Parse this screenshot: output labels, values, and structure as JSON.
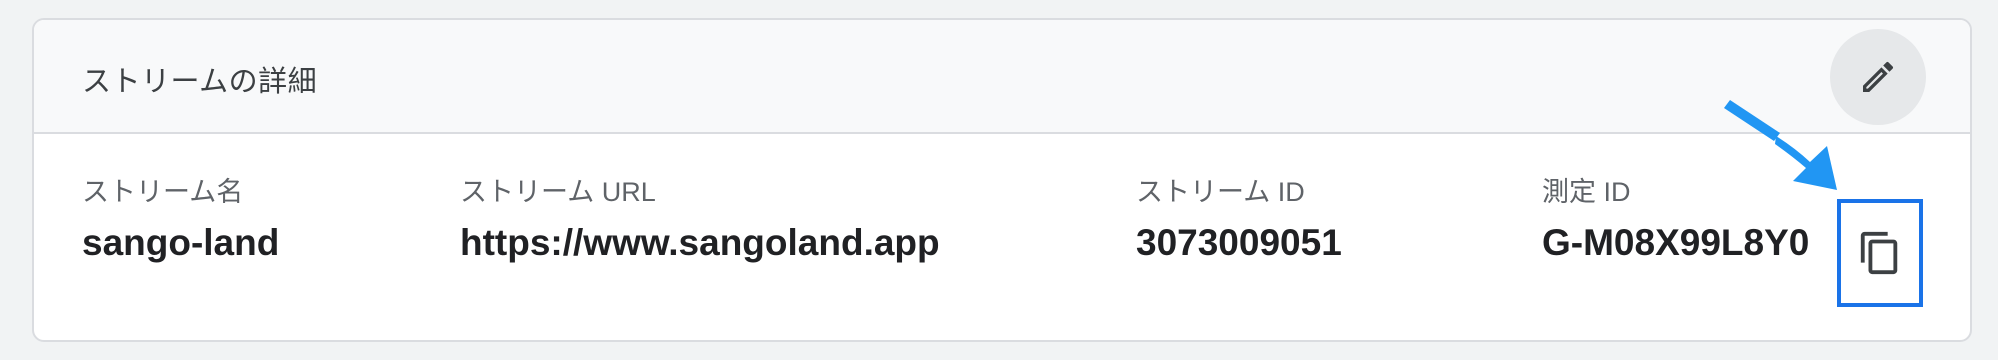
{
  "card": {
    "title": "ストリームの詳細",
    "edit_icon": "pencil-icon"
  },
  "fields": [
    {
      "label": "ストリーム名",
      "value": "sango-land"
    },
    {
      "label": "ストリーム URL",
      "value": "https://www.sangoland.app"
    },
    {
      "label": "ストリーム ID",
      "value": "3073009051"
    },
    {
      "label": "測定 ID",
      "value": "G-M08X99L8Y0"
    }
  ],
  "copy_button": {
    "icon": "copy-icon"
  },
  "annotation": {
    "type": "arrow-pointer",
    "color": "#2196f3"
  },
  "colors": {
    "highlight_border": "#1a73e8",
    "header_background": "#f8f9fa"
  }
}
